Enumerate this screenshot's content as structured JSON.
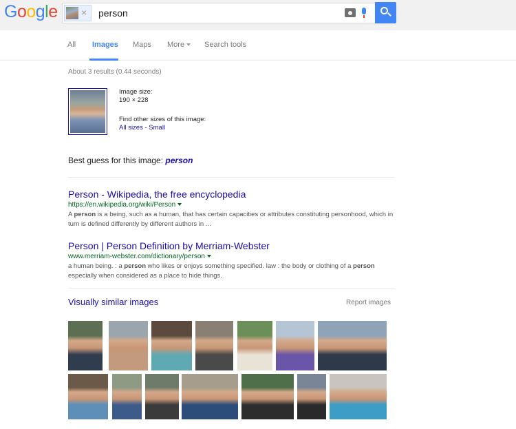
{
  "header": {
    "logo_letters": [
      {
        "char": "G",
        "color": "#4285f4"
      },
      {
        "char": "o",
        "color": "#ea4335"
      },
      {
        "char": "o",
        "color": "#fbbc05"
      },
      {
        "char": "g",
        "color": "#4285f4"
      },
      {
        "char": "l",
        "color": "#34a853"
      },
      {
        "char": "e",
        "color": "#ea4335"
      }
    ],
    "search_query": "person",
    "remove_image_glyph": "×"
  },
  "tabs": {
    "all": "All",
    "images": "Images",
    "maps": "Maps",
    "more": "More",
    "search_tools": "Search tools"
  },
  "stats": "About 3 results (0.44 seconds)",
  "image_info": {
    "size_label": "Image size:",
    "size_value": "190 × 228",
    "other_sizes_label": "Find other sizes of this image:",
    "all_sizes_link": "All sizes",
    "separator": " - ",
    "small_link": "Small"
  },
  "best_guess": {
    "label": "Best guess for this image:",
    "value": "person"
  },
  "results": [
    {
      "title": "Person - Wikipedia, the free encyclopedia",
      "url": "https://en.wikipedia.org/wiki/Person",
      "snippet_pre": "A ",
      "snippet_bold": "person",
      "snippet_post": " is a being, such as a human, that has certain capacities or attributes constituting personhood, which in turn is defined differently by different authors in ..."
    },
    {
      "title": "Person | Person Definition by Merriam-Webster",
      "url": "www.merriam-webster.com/dictionary/person",
      "snippet_pre": "a human being. : a ",
      "snippet_bold": "person",
      "snippet_mid": " who likes or enjoys something specified. law : the body or clothing of a ",
      "snippet_bold2": "person",
      "snippet_post": " especially when considered as a place to hide things."
    }
  ],
  "similar": {
    "title": "Visually similar images",
    "report_label": "Report images"
  },
  "colors": {
    "link": "#1a0dab",
    "url_green": "#006621",
    "accent_blue": "#4285f4"
  }
}
